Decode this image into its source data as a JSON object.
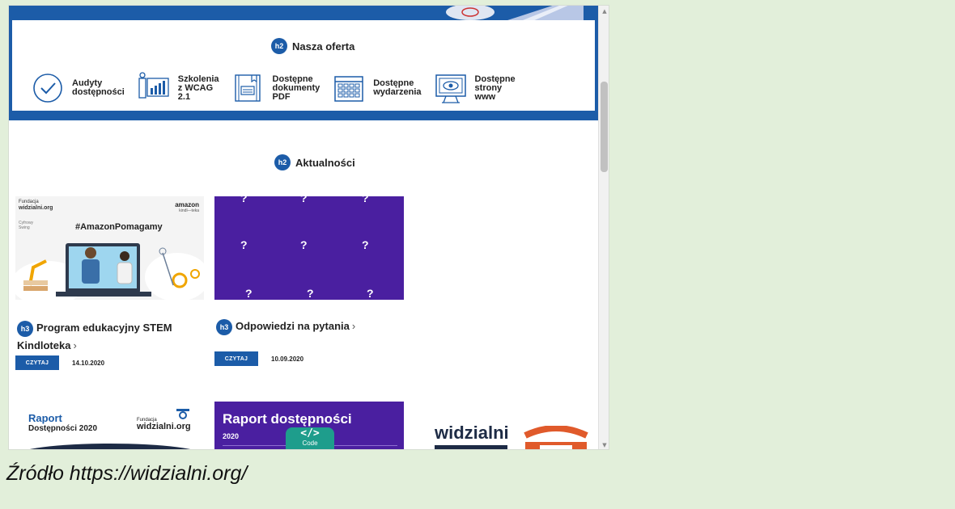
{
  "offer": {
    "heading_badge": "h2",
    "heading": "Nasza oferta",
    "items": [
      {
        "label": "Audyty\ndostępności",
        "icon": "checkmark-circle-icon"
      },
      {
        "label": "Szkolenia\nz WCAG\n2.1",
        "icon": "presentation-chart-icon"
      },
      {
        "label": "Dostępne\ndokumenty\nPDF",
        "icon": "document-icon"
      },
      {
        "label": "Dostępne\nwydarzenia",
        "icon": "calendar-icon"
      },
      {
        "label": "Dostępne\nstrony\nwww",
        "icon": "monitor-eye-icon"
      }
    ]
  },
  "news": {
    "heading_badge": "h2",
    "heading": "Aktualności",
    "card_badge": "h3",
    "read_label": "CZYTAJ",
    "cards": [
      {
        "title": "Program edukacyjny STEM Kindloteka",
        "chevron": "›",
        "date": "14.10.2020",
        "image": {
          "hashtag": "#AmazonPomagamy",
          "brand_left_small": "Fundacja",
          "brand_left": "widzialni.org",
          "brand_right": "amazon",
          "brand_right_sub": "kindl—teka",
          "logo_text": "Cyfrowy\nSwing"
        }
      },
      {
        "title": "Odpowiedzi na pytania",
        "chevron": "›",
        "date": "10.09.2020",
        "image": {
          "symbol": "?",
          "bg": "#4a1fa0"
        }
      }
    ],
    "row2": [
      {
        "title": "Raport",
        "subtitle": "Dostępności 2020",
        "logo_small": "Fundacja",
        "logo": "widzialni.org"
      },
      {
        "title": "Raport dostępności",
        "year": "2020",
        "overlay_symbol": "</>",
        "overlay_label": "Code",
        "bg": "#4a1fa0"
      },
      {
        "logo": "widzialni"
      }
    ]
  },
  "scrollbar": {
    "up": "▲",
    "down": "▼"
  },
  "caption": "Źródło https://widzialni.org/",
  "colors": {
    "brand_blue": "#1c5ca8",
    "purple": "#4a1fa0",
    "page_bg": "#e2efda",
    "accent_orange": "#e05a2b"
  }
}
